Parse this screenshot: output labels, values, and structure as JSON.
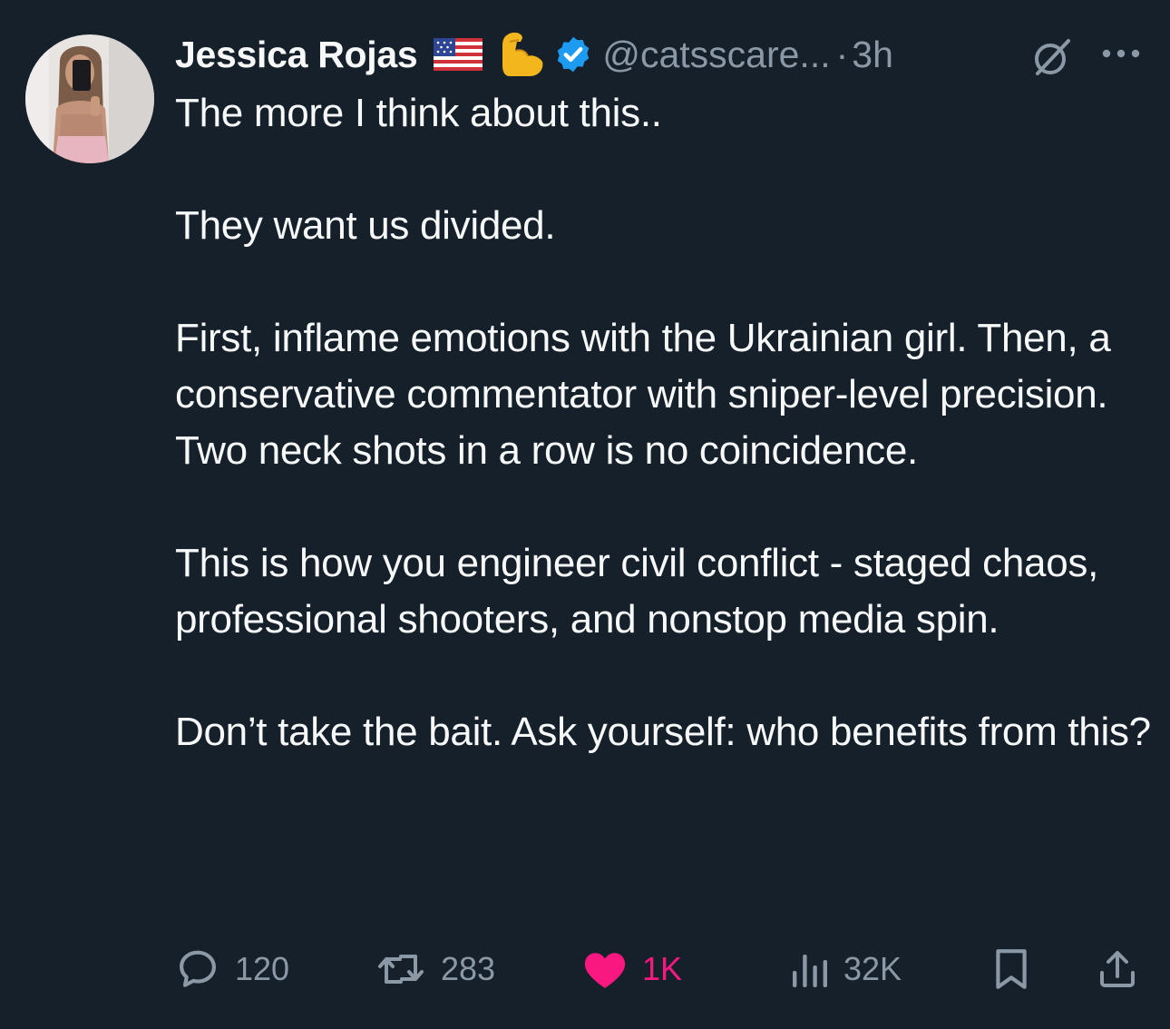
{
  "tweet": {
    "author": {
      "display_name": "Jessica Rojas",
      "handle": "@catsscare...",
      "verified": true,
      "name_emojis": [
        "us-flag",
        "flexed-biceps"
      ]
    },
    "separator": "·",
    "time": "3h",
    "paragraphs": [
      "The more I think about this..",
      "They want us divided.",
      "First, inflame emotions with the Ukrainian girl. Then, a conservative commentator with sniper-level precision. Two neck shots in a row is no coincidence.",
      "This is how you engineer civil conflict - staged chaos, professional shooters, and nonstop media spin.",
      "Don’t take the bait. Ask yourself: who benefits from this?"
    ],
    "actions": {
      "reply_count": "120",
      "retweet_count": "283",
      "like_count": "1K",
      "views_count": "32K"
    },
    "liked": true
  },
  "colors": {
    "background": "#15202b",
    "text": "#f7f9f9",
    "secondary": "#8b98a5",
    "verified": "#1d9bf0",
    "like": "#f91880"
  },
  "icons": {
    "reply": "comment-bubble-icon",
    "retweet": "retweet-icon",
    "like": "heart-filled-icon",
    "views": "views-bars-icon",
    "bookmark": "bookmark-icon",
    "share": "share-icon",
    "grok": "grok-icon",
    "more": "more-dots-icon"
  }
}
